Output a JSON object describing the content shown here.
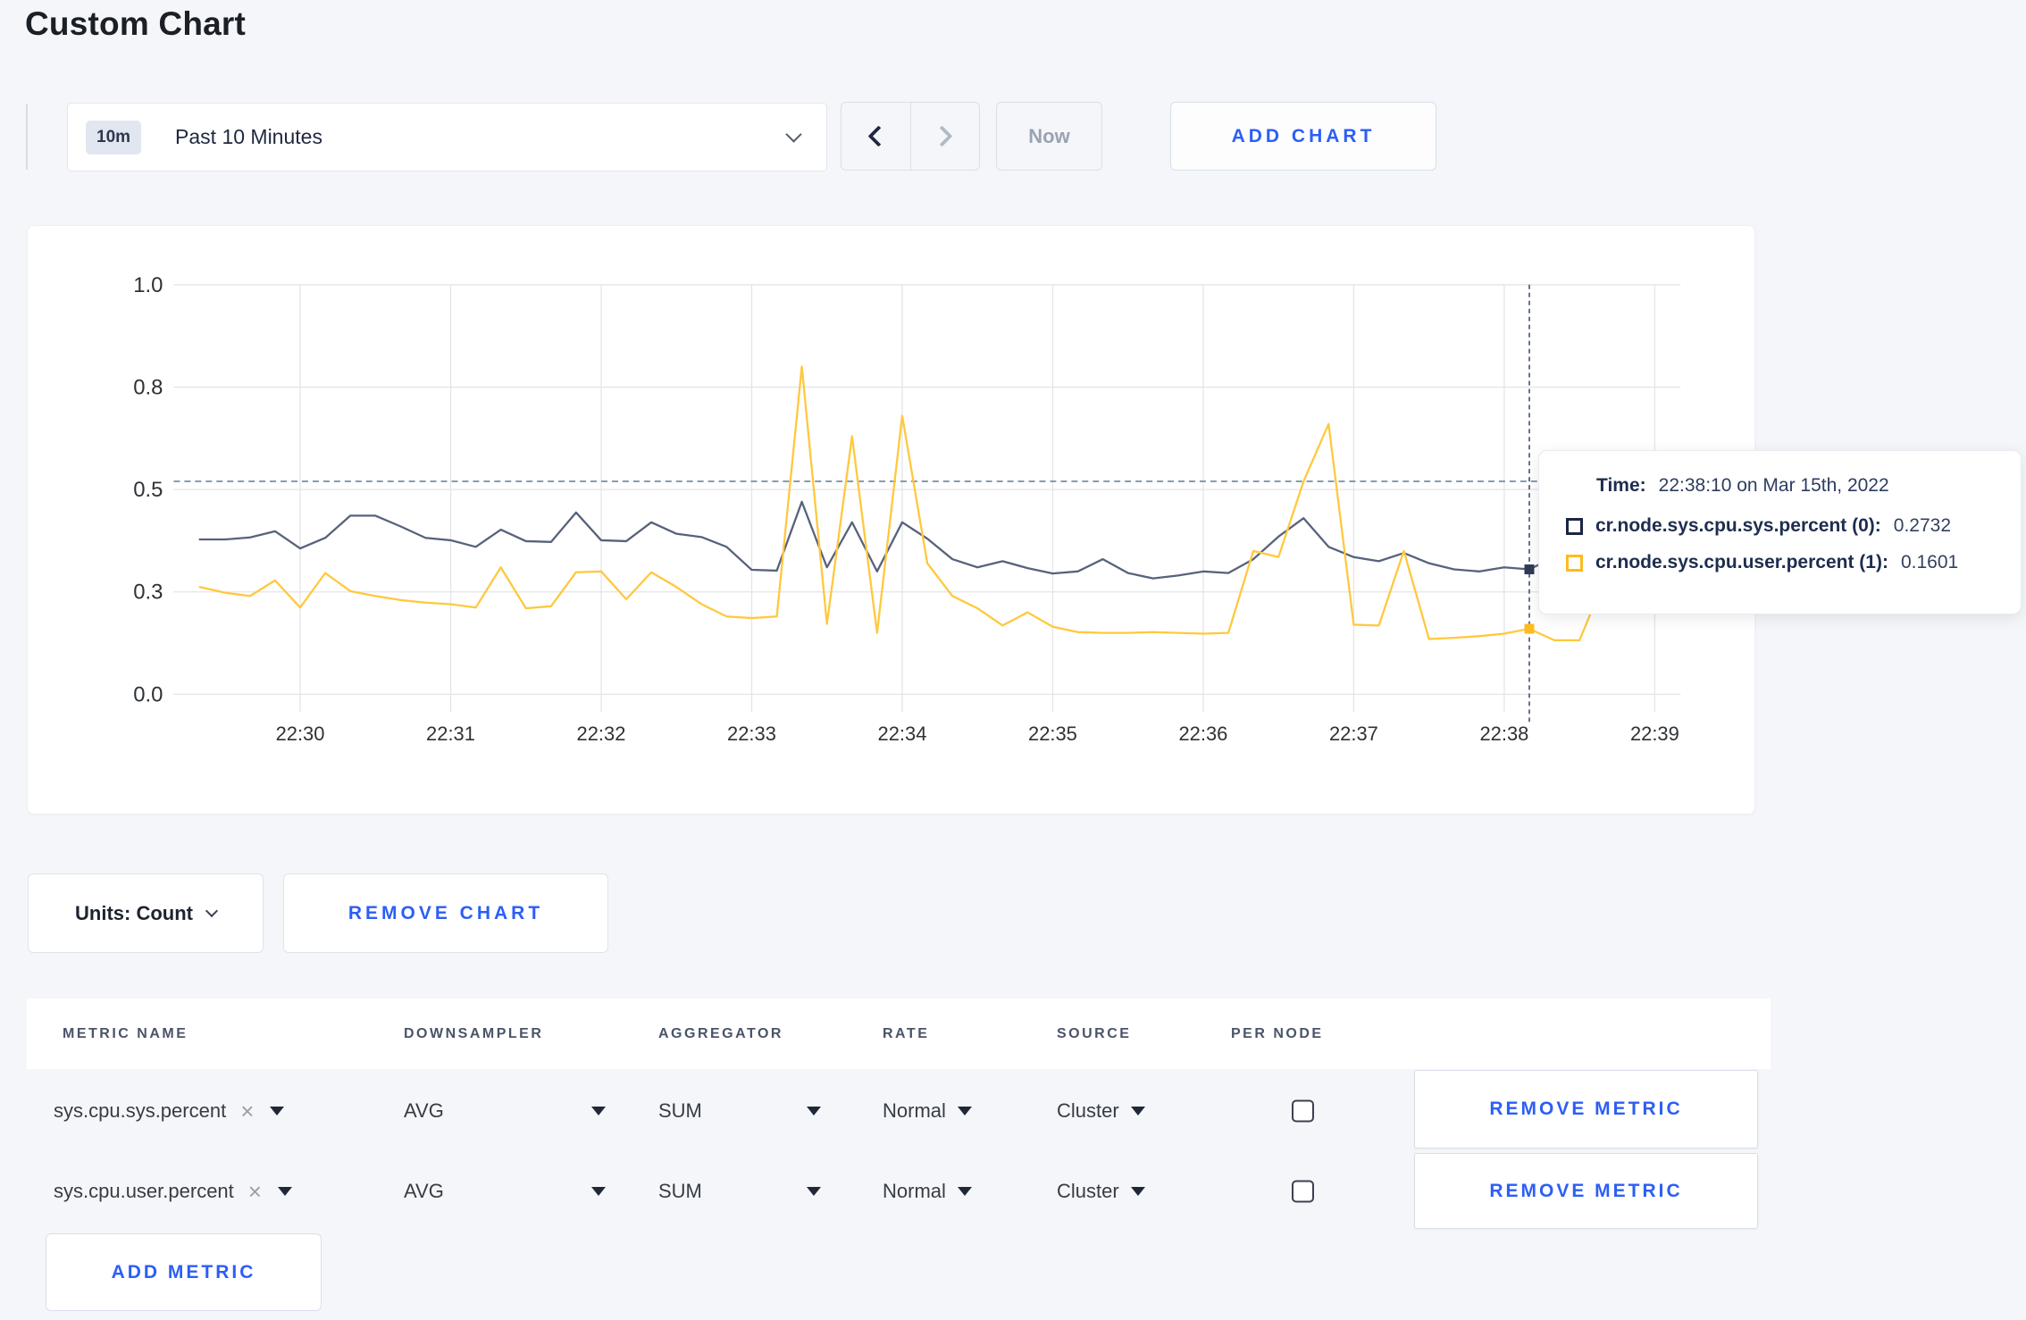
{
  "page": {
    "title": "Custom Chart"
  },
  "toolbar": {
    "time_window": {
      "badge": "10m",
      "label": "Past 10 Minutes"
    },
    "now_label": "Now",
    "add_chart_label": "ADD CHART"
  },
  "chart_data": {
    "type": "line",
    "title": "",
    "xlabel": "",
    "ylabel": "",
    "ylim": [
      0,
      1
    ],
    "grid": true,
    "x_tick_labels": [
      "22:30",
      "22:31",
      "22:32",
      "22:33",
      "22:34",
      "22:35",
      "22:36",
      "22:37",
      "22:38",
      "22:39"
    ],
    "y_tick_labels": [
      "0.0",
      "0.3",
      "0.5",
      "0.8",
      "1.0"
    ],
    "y_tick_values": [
      0,
      0.25,
      0.5,
      0.75,
      1.0
    ],
    "x_step_seconds": 10,
    "x_first_point_offset_seconds": -40,
    "x_first_tick_time": "22:30:00",
    "dashed_reference_value": 0.52,
    "hover": {
      "index": 53,
      "time": "22:38:10"
    },
    "legend_position": "tooltip",
    "series": [
      {
        "name": "cr.node.sys.cpu.sys.percent (0)",
        "color": "#57627b",
        "marker_color": "#2f3a55",
        "values": [
          0.378,
          0.378,
          0.383,
          0.398,
          0.356,
          0.382,
          0.436,
          0.436,
          0.41,
          0.382,
          0.376,
          0.36,
          0.402,
          0.374,
          0.372,
          0.444,
          0.376,
          0.374,
          0.42,
          0.392,
          0.384,
          0.36,
          0.304,
          0.302,
          0.47,
          0.31,
          0.42,
          0.3,
          0.42,
          0.38,
          0.33,
          0.31,
          0.325,
          0.308,
          0.295,
          0.3,
          0.33,
          0.296,
          0.283,
          0.29,
          0.3,
          0.296,
          0.33,
          0.385,
          0.43,
          0.36,
          0.335,
          0.325,
          0.345,
          0.32,
          0.305,
          0.3,
          0.31,
          0.305,
          0.335,
          0.31,
          0.3,
          0.31,
          0.32,
          0.345
        ]
      },
      {
        "name": "cr.node.sys.cpu.user.percent (1)",
        "color": "#ffc83d",
        "marker_color": "#fdbb1f",
        "values": [
          0.262,
          0.248,
          0.24,
          0.278,
          0.212,
          0.296,
          0.252,
          0.24,
          0.23,
          0.224,
          0.22,
          0.212,
          0.31,
          0.21,
          0.215,
          0.298,
          0.3,
          0.232,
          0.298,
          0.262,
          0.22,
          0.19,
          0.186,
          0.19,
          0.8,
          0.172,
          0.63,
          0.15,
          0.68,
          0.32,
          0.24,
          0.21,
          0.168,
          0.2,
          0.165,
          0.152,
          0.15,
          0.15,
          0.152,
          0.15,
          0.148,
          0.15,
          0.35,
          0.335,
          0.52,
          0.66,
          0.17,
          0.168,
          0.35,
          0.135,
          0.138,
          0.142,
          0.148,
          0.16,
          0.132,
          0.132,
          0.28,
          0.3,
          0.22,
          0.27
        ]
      }
    ]
  },
  "tooltip": {
    "time_label": "Time:",
    "time_value": "22:38:10 on Mar 15th, 2022",
    "rows": [
      {
        "label": "cr.node.sys.cpu.sys.percent (0):",
        "value": "0.2732",
        "swatch_color": "#1b2644"
      },
      {
        "label": "cr.node.sys.cpu.user.percent (1):",
        "value": "0.1601",
        "swatch_color": "#fdbb1f"
      }
    ]
  },
  "chart_footer": {
    "units_label": "Units: Count",
    "remove_chart_label": "REMOVE CHART"
  },
  "metrics_table": {
    "columns": [
      "METRIC NAME",
      "DOWNSAMPLER",
      "AGGREGATOR",
      "RATE",
      "SOURCE",
      "PER NODE"
    ],
    "clear_icon": "×",
    "rows": [
      {
        "metric_name": "sys.cpu.sys.percent",
        "downsampler": "AVG",
        "aggregator": "SUM",
        "rate": "Normal",
        "source": "Cluster",
        "per_node_checked": false,
        "remove_label": "REMOVE METRIC"
      },
      {
        "metric_name": "sys.cpu.user.percent",
        "downsampler": "AVG",
        "aggregator": "SUM",
        "rate": "Normal",
        "source": "Cluster",
        "per_node_checked": false,
        "remove_label": "REMOVE METRIC"
      }
    ],
    "add_metric_label": "ADD METRIC"
  }
}
